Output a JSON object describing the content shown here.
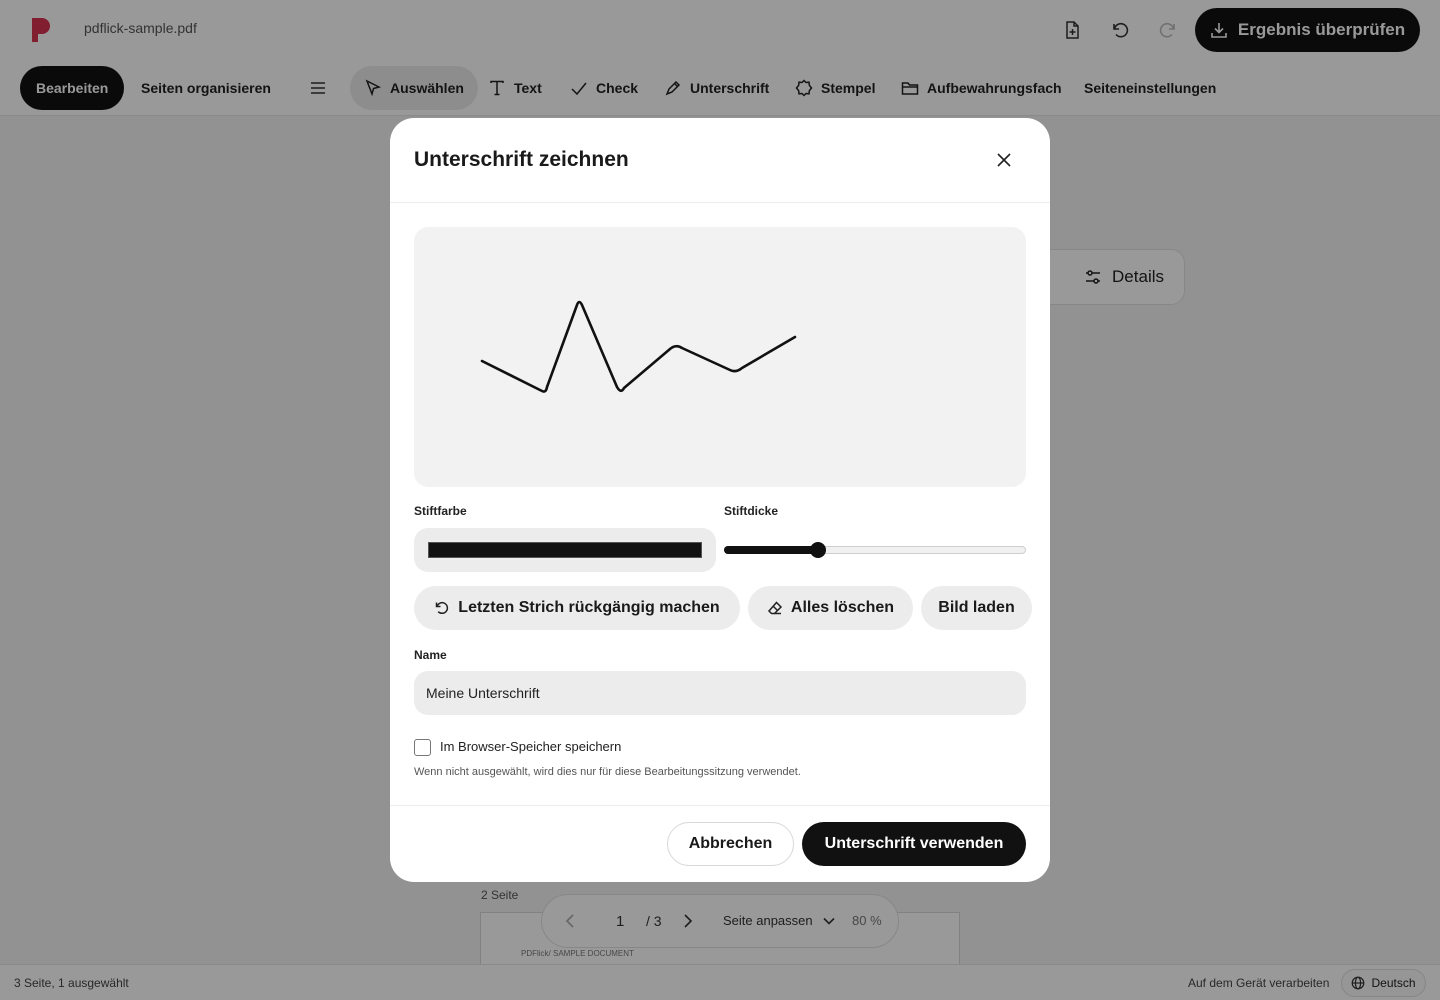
{
  "header": {
    "filename": "pdflick-sample.pdf",
    "review_button": "Ergebnis überprüfen",
    "icons": [
      "add-file-icon",
      "undo-icon",
      "redo-icon",
      "download-icon"
    ]
  },
  "toolbar": {
    "tabs": [
      {
        "label": "Bearbeiten",
        "active": true
      },
      {
        "label": "Seiten organisieren",
        "active": false
      }
    ],
    "tools": [
      {
        "label": "Auswählen",
        "icon": "cursor-icon",
        "active": true
      },
      {
        "label": "Text",
        "icon": "text-icon"
      },
      {
        "label": "Check",
        "icon": "check-icon"
      },
      {
        "label": "Unterschrift",
        "icon": "pen-icon"
      },
      {
        "label": "Stempel",
        "icon": "stamp-icon"
      },
      {
        "label": "Aufbewahrungsfach",
        "icon": "folder-icon"
      },
      {
        "label": "Seiteneinstellungen"
      }
    ]
  },
  "workspace": {
    "details_label": "Details",
    "page_label": "2 Seite",
    "page_doc_text": "PDFlick/ SAMPLE DOCUMENT",
    "pager": {
      "current_page": "1",
      "total": "/ 3",
      "fit_label": "Seite anpassen",
      "zoom": "80 %"
    }
  },
  "statusbar": {
    "left": "3 Seite, 1 ausgewählt",
    "right": "Auf dem Gerät verarbeiten",
    "language": "Deutsch"
  },
  "modal": {
    "title": "Unterschrift zeichnen",
    "pen_color_label": "Stiftfarbe",
    "pen_color": "#111111",
    "pen_thickness_label": "Stiftdicke",
    "pen_thickness_fraction": 0.31,
    "undo_stroke": "Letzten Strich rückgängig machen",
    "clear_all": "Alles löschen",
    "load_image": "Bild laden",
    "name_label": "Name",
    "name_value": "Meine Unterschrift",
    "save_checkbox_label": "Im Browser-Speicher speichern",
    "save_checked": false,
    "hint": "Wenn nicht ausgewählt, wird dies nur für diese Bearbeitungssitzung verwendet.",
    "cancel": "Abbrechen",
    "use_signature": "Unterschrift verwenden"
  },
  "colors": {
    "primary": "#111111",
    "brand": "#d8324f",
    "overlay": "rgba(0,0,0,0.40)"
  }
}
